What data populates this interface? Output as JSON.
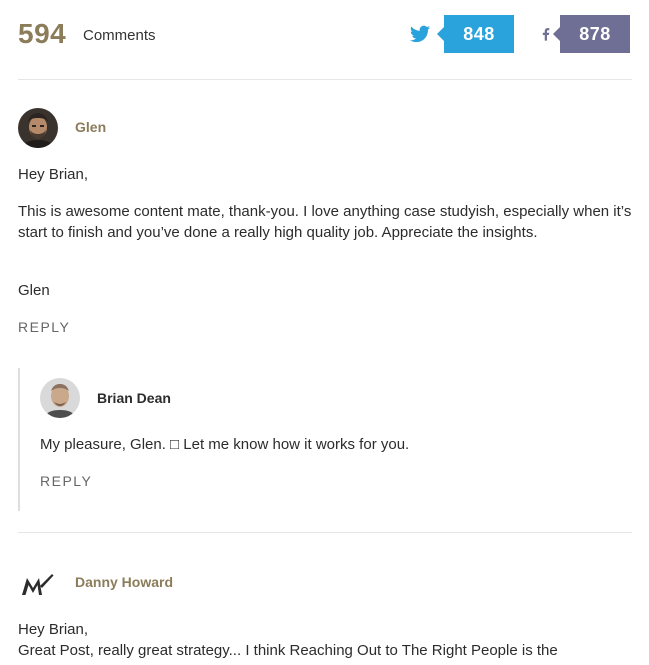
{
  "header": {
    "comment_count": "594",
    "comment_label": "Comments",
    "twitter": {
      "icon": "twitter-bird-icon",
      "count": "848",
      "color": "#2aa3dc"
    },
    "facebook": {
      "icon": "facebook-f-icon",
      "count": "878",
      "color": "#6f6e94"
    }
  },
  "comments": [
    {
      "author": "Glen",
      "paragraphs": [
        "Hey Brian,",
        "This is awesome content mate, thank-you. I love anything case studyish, especially when it’s start to finish and you’ve done a really high quality job. Appreciate the insights.",
        "Glen"
      ],
      "reply_label": "REPLY",
      "replies": [
        {
          "author": "Brian Dean",
          "text": "My pleasure, Glen. □ Let me know how it works for you.",
          "reply_label": "REPLY"
        }
      ]
    },
    {
      "author": "Danny Howard",
      "paragraphs": [
        "Hey Brian,",
        "Great Post, really great strategy... I think Reaching Out to The Right People is the"
      ]
    }
  ],
  "colors": {
    "accent_gold": "#8b7c5a",
    "text": "#2c2c2c",
    "muted": "#666666",
    "divider": "#e6e6e6"
  }
}
